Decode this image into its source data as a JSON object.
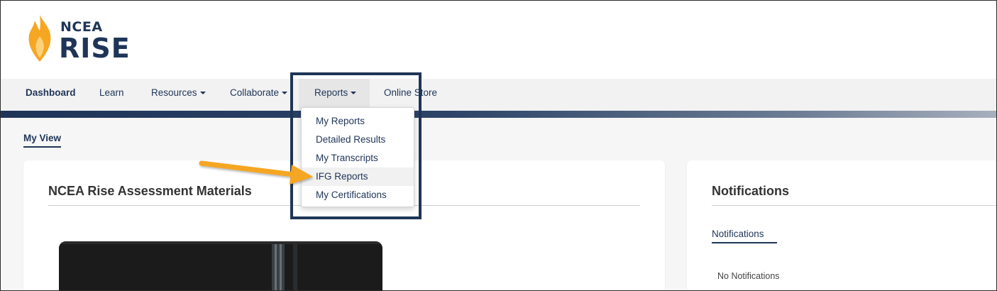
{
  "brand": {
    "line1": "NCEA",
    "line2": "RISE",
    "flame_color": "#f5a623",
    "navy": "#1f3558"
  },
  "nav": {
    "items": [
      {
        "label": "Dashboard",
        "dropdown": false,
        "active": true
      },
      {
        "label": "Learn",
        "dropdown": false
      },
      {
        "label": "Resources",
        "dropdown": true
      },
      {
        "label": "Collaborate",
        "dropdown": true
      },
      {
        "label": "Reports",
        "dropdown": true,
        "open": true
      },
      {
        "label": "Online Store",
        "dropdown": false
      }
    ]
  },
  "reports_menu": {
    "items": [
      "My Reports",
      "Detailed Results",
      "My Transcripts",
      "IFG Reports",
      "My Certifications"
    ],
    "hovered": "IFG Reports"
  },
  "view_tab": {
    "label": "My View"
  },
  "assessment_card": {
    "title": "NCEA Rise Assessment Materials"
  },
  "notifications_card": {
    "title": "Notifications",
    "tab_label": "Notifications",
    "empty_text": "No Notifications"
  },
  "annotation": {
    "arrow_color": "#f5a623",
    "box_color": "#1f3558",
    "points_to": "IFG Reports"
  },
  "icons": [
    "flame-logo-icon",
    "caret-down-icon",
    "pointer-arrow-icon"
  ]
}
